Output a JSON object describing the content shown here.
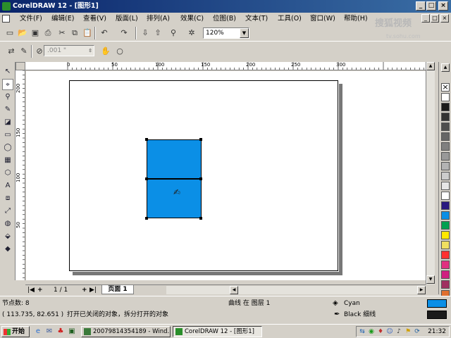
{
  "window": {
    "title": "CorelDRAW 12 - [图形1]",
    "min_label": "_",
    "max_label": "□",
    "close_label": "×"
  },
  "menu": {
    "items": [
      "文件(F)",
      "编辑(E)",
      "查看(V)",
      "版面(L)",
      "排列(A)",
      "效果(C)",
      "位图(B)",
      "文本(T)",
      "工具(O)",
      "窗口(W)",
      "帮助(H)"
    ]
  },
  "watermark": {
    "text": "搜狐视频",
    "url": "tv.sohu.com"
  },
  "toolbar": {
    "zoom_value": "120%",
    "zoom_arrow": "▼",
    "nudge_value": ".001 \"",
    "icons": [
      "new-doc",
      "open",
      "save",
      "print",
      "cut",
      "copy",
      "paste",
      "undo",
      "redo",
      "import",
      "export",
      "app-launcher",
      "corel-online",
      "zoom-levels"
    ]
  },
  "rulers": {
    "horizontal": [
      {
        "label": "0"
      },
      {
        "label": "50"
      },
      {
        "label": "100"
      },
      {
        "label": "150"
      },
      {
        "label": "200"
      },
      {
        "label": "250"
      },
      {
        "label": "300"
      }
    ],
    "vertical": [
      {
        "label": "200"
      },
      {
        "label": "150"
      },
      {
        "label": "100"
      },
      {
        "label": "50"
      }
    ]
  },
  "page_nav": {
    "first": "|◀",
    "add_before": "+",
    "counter": "1 / 1",
    "add_after": "+",
    "last": "▶|",
    "tab_label": "页面 1"
  },
  "status": {
    "node_count": "节点数: 8",
    "coords": "( 113.735, 82.651 )",
    "hint": "打开已关闭的对象，拆分打开的对象",
    "object_info": "曲线 在 图层 1",
    "fill_name": "Cyan",
    "outline_name": "Black  细线",
    "fill_color": "#0b8fe6",
    "outline_color": "#1a1a1a"
  },
  "palette": [
    "#ffffff",
    "#1a1a1a",
    "#333333",
    "#4d4d4d",
    "#666666",
    "#808080",
    "#999999",
    "#b3b3b3",
    "#cccccc",
    "#e6e6e6",
    "#ffffff",
    "#2a1a80",
    "#0b8fe6",
    "#00a050",
    "#ffe800",
    "#f0e060",
    "#ff3030",
    "#e03080",
    "#d02080",
    "#a03060",
    "#e07030"
  ],
  "taskbar": {
    "start_label": "开始",
    "tasks": [
      {
        "label": "20079814354189 - Wind..."
      },
      {
        "label": "CorelDRAW 12 - [图形1]"
      }
    ],
    "clock": "21:32"
  }
}
